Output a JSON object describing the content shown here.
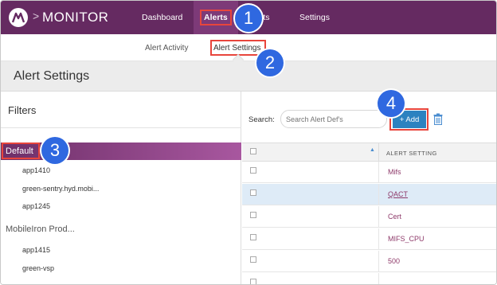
{
  "app": {
    "brand": "MONITOR",
    "breadcrumb_chevron": ">"
  },
  "nav": {
    "items": [
      {
        "label": "Dashboard"
      },
      {
        "label": "Alerts"
      },
      {
        "label": "orts"
      },
      {
        "label": "Settings"
      }
    ]
  },
  "subnav": {
    "items": [
      {
        "label": "Alert Activity"
      },
      {
        "label": "Alert Settings"
      }
    ]
  },
  "page": {
    "title": "Alert Settings"
  },
  "filters": {
    "title": "Filters",
    "default_group": "Default",
    "default_items": [
      "app1410",
      "green-sentry.hyd.mobi...",
      "app1245"
    ],
    "group2": "MobileIron Prod...",
    "group2_items": [
      "app1415",
      "green-vsp"
    ]
  },
  "alerts": {
    "search_label": "Search:",
    "search_placeholder": "Search Alert Def's",
    "add_label": "+ Add",
    "column_header": "ALERT SETTING",
    "rows": [
      "Mifs",
      "QACT",
      "Cert",
      "MIFS_CPU",
      "500"
    ]
  },
  "steps": [
    "1",
    "2",
    "3",
    "4"
  ],
  "colors": {
    "nav_bg": "#652a61",
    "accent": "#2c82c0",
    "highlight": "#e8453c",
    "badge": "#2f68e0"
  }
}
